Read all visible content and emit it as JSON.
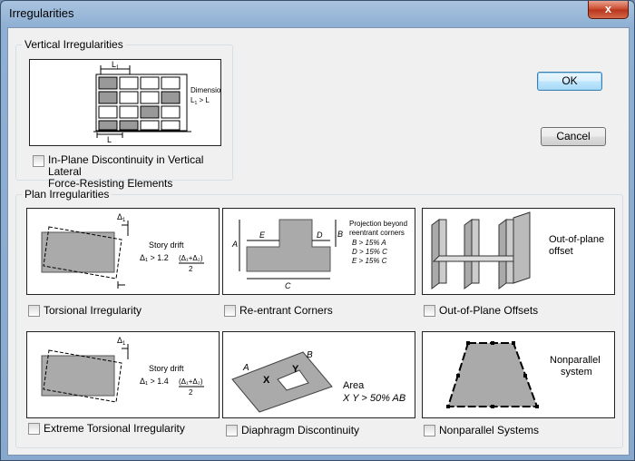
{
  "window": {
    "title": "Irregularities",
    "close_glyph": "x"
  },
  "buttons": {
    "ok": "OK",
    "cancel": "Cancel"
  },
  "vertical": {
    "group_label": "Vertical Irregularities",
    "diagram": {
      "l1": "L",
      "l1_sub": "1",
      "l": "L",
      "dimension": "Dimension",
      "rule_l1": "L",
      "rule_sub": "1",
      "rule_rest": " > L"
    },
    "checkbox_line1": "In-Plane Discontinuity in Vertical Lateral",
    "checkbox_line2": "Force-Resisting Elements"
  },
  "plan": {
    "group_label": "Plan Irregularities",
    "torsional": {
      "label": "Torsional Irregularity",
      "delta": "Δ",
      "delta_sub": "1",
      "caption": "Story drift",
      "formula_left": "Δ₁ > 1.2",
      "formula_num": "(Δ₁+Δ₂)",
      "formula_den": "2"
    },
    "reentrant": {
      "label": "Re-entrant Corners",
      "e": "E",
      "d": "D",
      "a": "A",
      "b": "B",
      "c": "C",
      "text1": "Projection beyond",
      "text2": "reentrant corners",
      "rule1": "B > 15% A",
      "rule2": "D > 15% C",
      "rule3": "E > 15% C"
    },
    "outofplane": {
      "label": "Out-of-Plane Offsets",
      "text1": "Out-of-plane",
      "text2": "offset"
    },
    "extreme": {
      "label": "Extreme Torsional Irregularity",
      "delta": "Δ",
      "delta_sub": "1",
      "caption": "Story drift",
      "formula_left": "Δ₁ > 1.4",
      "formula_num": "(Δ₁+Δ₂)",
      "formula_den": "2"
    },
    "diaphragm": {
      "label": "Diaphragm Discontinuity",
      "a": "A",
      "b": "B",
      "x": "X",
      "y": "Y",
      "area": "Area",
      "rule": "X Y > 50% AB"
    },
    "nonparallel": {
      "label": "Nonparallel Systems",
      "text1": "Nonparallel",
      "text2": "system"
    }
  }
}
